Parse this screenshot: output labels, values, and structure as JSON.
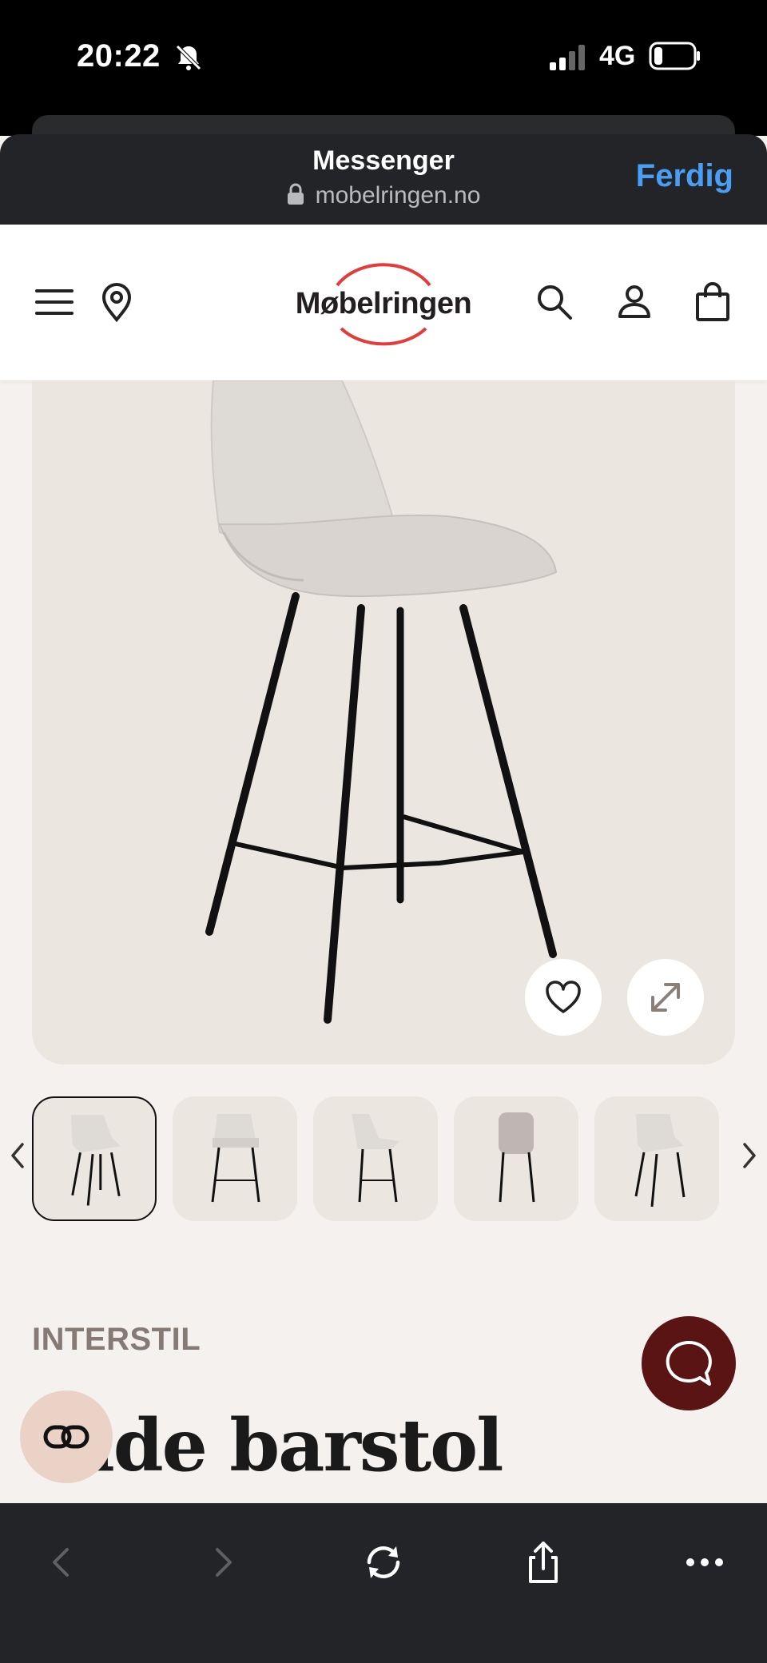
{
  "status_bar": {
    "time": "20:22",
    "network": "4G"
  },
  "sheet": {
    "title": "Messenger",
    "url": "mobelringen.no",
    "done_label": "Ferdig"
  },
  "site": {
    "logo_text": "Møbelringen"
  },
  "product": {
    "brand": "INTERSTIL",
    "title": "rade barstol"
  },
  "icons": {
    "menu": "menu-icon",
    "location": "location-pin-icon",
    "search": "search-icon",
    "account": "user-icon",
    "cart": "shopping-bag-icon",
    "favorite": "heart-icon",
    "expand": "expand-icon",
    "chat": "chat-bubble-icon",
    "assist": "link-icon"
  },
  "colors": {
    "accent_red": "#e53b3b",
    "done_blue": "#4a9ff5",
    "chat_button": "#5a1414",
    "hero_bg": "#ece6e1",
    "page_bg": "#f5f1ee"
  }
}
